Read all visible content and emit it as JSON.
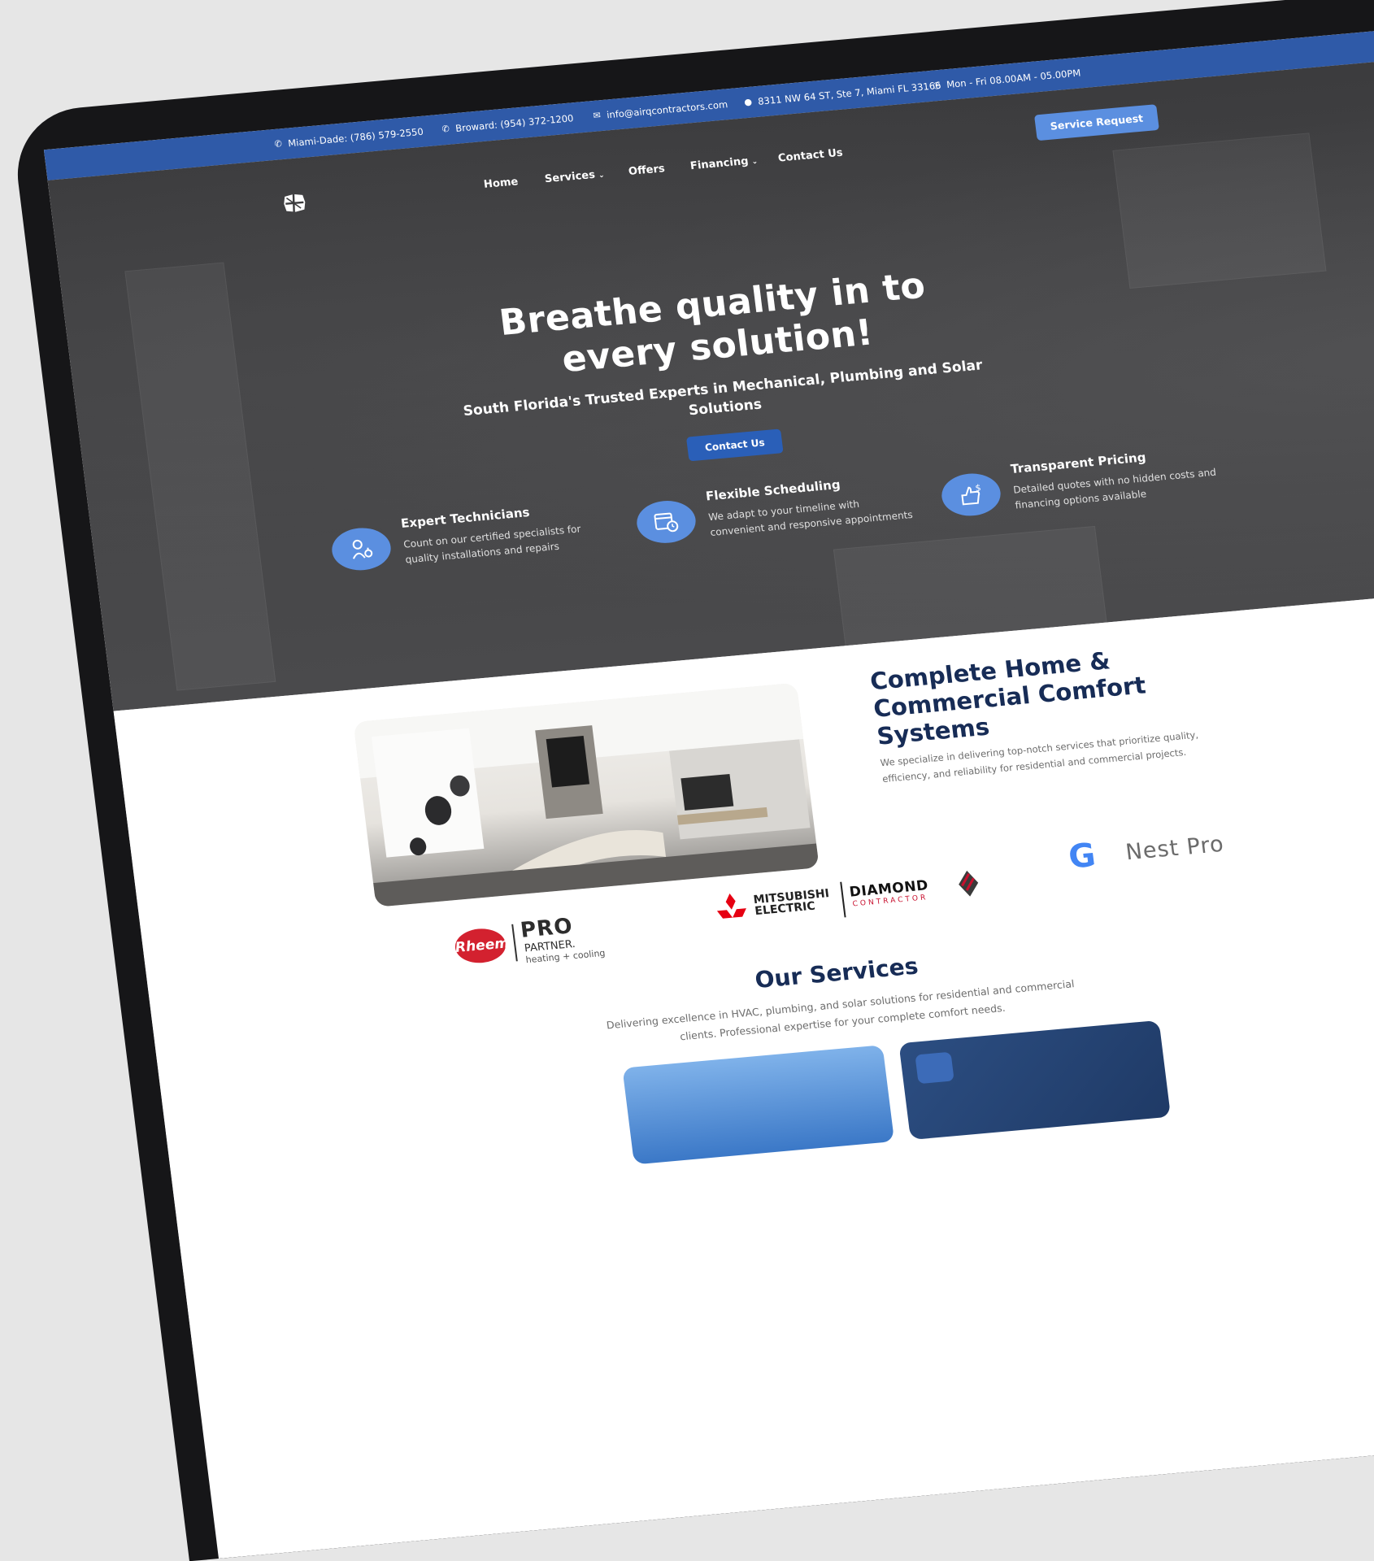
{
  "topbar": {
    "miami_dade": "Miami-Dade: (786) 579-2550",
    "broward": "Broward: (954) 372-1200",
    "email": "info@airqcontractors.com",
    "address": "8311 NW 64 ST, Ste 7, Miami FL 33166",
    "hours": "Mon - Fri 08.00AM - 05.00PM",
    "icons": [
      "phone-icon",
      "phone-icon",
      "mail-icon",
      "location-pin-icon",
      "clock-icon"
    ]
  },
  "nav": {
    "home": "Home",
    "services": "Services",
    "offers": "Offers",
    "financing": "Financing",
    "contact": "Contact Us",
    "service_request": "Service Request"
  },
  "hero": {
    "title_line1": "Breathe quality in to",
    "title_line2": "every solution!",
    "subtitle_line1": "South Florida's Trusted Experts in Mechanical, Plumbing and Solar",
    "subtitle_line2": "Solutions",
    "cta": "Contact Us"
  },
  "features": [
    {
      "icon": "technician-gear-icon",
      "title": "Expert Technicians",
      "desc": "Count on our certified specialists for quality installations and repairs"
    },
    {
      "icon": "calendar-clock-icon",
      "title": "Flexible Scheduling",
      "desc": "We adapt to your timeline with convenient and responsive appointments"
    },
    {
      "icon": "thumbs-up-dollar-icon",
      "title": "Transparent Pricing",
      "desc": "Detailed quotes with no hidden costs and financing options available"
    }
  ],
  "comfort": {
    "title": "Complete Home & Commercial Comfort Systems",
    "desc": "We specialize in delivering top-notch services that prioritize quality, efficiency, and reliability for residential and commercial projects."
  },
  "partners": {
    "rheem": "Rheem",
    "pro": "PRO",
    "partner": "PARTNER.",
    "heating": "heating + cooling",
    "mitsubishi_1": "MITSUBISHI",
    "mitsubishi_2": "ELECTRIC",
    "diamond_1": "DIAMOND",
    "diamond_2": "CONTRACTOR",
    "nest": "Nest Pro",
    "google_letter": "G"
  },
  "services": {
    "title": "Our Services",
    "desc_line1": "Delivering excellence in HVAC, plumbing, and solar solutions for residential and commercial",
    "desc_line2": "clients. Professional expertise for your complete comfort needs."
  },
  "colors": {
    "topbar": "#2f5aa8",
    "accent": "#5b8fe0",
    "cta": "#2a5fb8",
    "heading": "#172c56",
    "rheem_red": "#d3212f",
    "mitsubishi_red": "#e60012",
    "diamond_red": "#c8102e"
  }
}
